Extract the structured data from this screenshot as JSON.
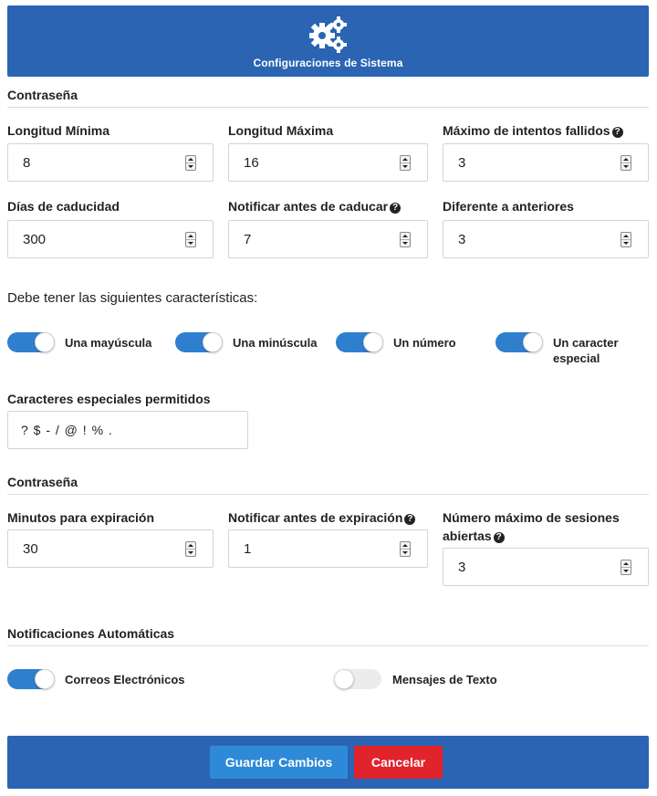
{
  "header": {
    "title": "Configuraciones de Sistema",
    "icon": "gears-icon",
    "color": "#2a64b3"
  },
  "password_section": {
    "title": "Contraseña",
    "fields": [
      {
        "label": "Longitud Mínima",
        "value": "8",
        "help": false
      },
      {
        "label": "Longitud Máxima",
        "value": "16",
        "help": false
      },
      {
        "label": "Máximo de intentos fallidos",
        "value": "3",
        "help": true
      },
      {
        "label": "Días de caducidad",
        "value": "300",
        "help": false
      },
      {
        "label": "Notificar antes de caducar",
        "value": "7",
        "help": true
      },
      {
        "label": "Diferente a anteriores",
        "value": "3",
        "help": false
      }
    ],
    "requirements_title": "Debe tener las siguientes características:",
    "requirements": [
      {
        "label": "Una mayúscula",
        "on": true
      },
      {
        "label": "Una minúscula",
        "on": true
      },
      {
        "label": "Un número",
        "on": true
      },
      {
        "label": "Un caracter especial",
        "on": true
      }
    ],
    "special_chars_label": "Caracteres especiales permitidos",
    "special_chars_value": "? $ - / @ ! % ."
  },
  "session_section": {
    "title": "Contraseña",
    "fields": [
      {
        "label": "Minutos para expiración",
        "value": "30",
        "help": false
      },
      {
        "label": "Notificar antes de expiración",
        "value": "1",
        "help": true
      },
      {
        "label": "Número máximo de sesiones abiertas",
        "value": "3",
        "help": true
      }
    ]
  },
  "notifications_section": {
    "title": "Notificaciones Automáticas",
    "toggles": [
      {
        "label": "Correos Electrónicos",
        "on": true
      },
      {
        "label": "Mensajes de Texto",
        "on": false
      }
    ]
  },
  "footer": {
    "save_label": "Guardar Cambios",
    "cancel_label": "Cancelar",
    "save_color": "#2e8ad8",
    "cancel_color": "#e1232c"
  },
  "help_icon": "question-circle-icon"
}
